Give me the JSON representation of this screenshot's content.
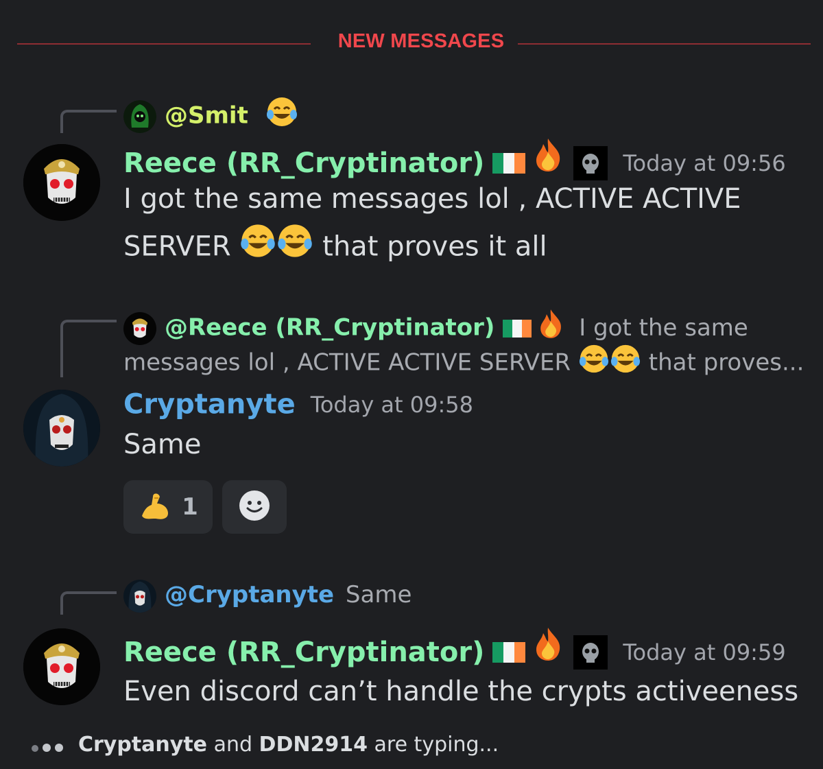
{
  "divider": {
    "label": "NEW MESSAGES"
  },
  "messages": [
    {
      "reply": {
        "mention": "@Smit",
        "preview": ""
      },
      "author": "Reece (RR_Cryptinator)",
      "timestamp": "Today at 09:56",
      "lines": [
        "I got the same messages lol , ACTIVE ACTIVE",
        "SERVER",
        "that proves it all"
      ]
    },
    {
      "reply": {
        "mention": "@Reece (RR_Cryptinator)",
        "preview_line1": "I got the same",
        "preview_line2a": "messages lol , ACTIVE ACTIVE SERVER",
        "preview_line2b": "that proves..."
      },
      "author": "Cryptanyte",
      "timestamp": "Today at 09:58",
      "lines": [
        "Same"
      ],
      "reactions": [
        {
          "icon": "flexed-biceps-icon",
          "count": "1"
        },
        {
          "icon": "add-reaction-icon"
        }
      ]
    },
    {
      "reply": {
        "mention": "@Cryptanyte",
        "preview": "Same"
      },
      "author": "Reece (RR_Cryptinator)",
      "timestamp": "Today at 09:59",
      "lines": [
        "Even discord can’t handle the crypts activeeness"
      ]
    }
  ],
  "typing": {
    "user1": "Cryptanyte",
    "and": " and ",
    "user2": "DDN2914",
    "suffix": " are typing..."
  },
  "colors": {
    "divider": "#f0474c",
    "reece": "#86efac",
    "cryptanyte": "#5aa9e6",
    "smit": "#d4f06a",
    "background": "#1e1f22"
  }
}
